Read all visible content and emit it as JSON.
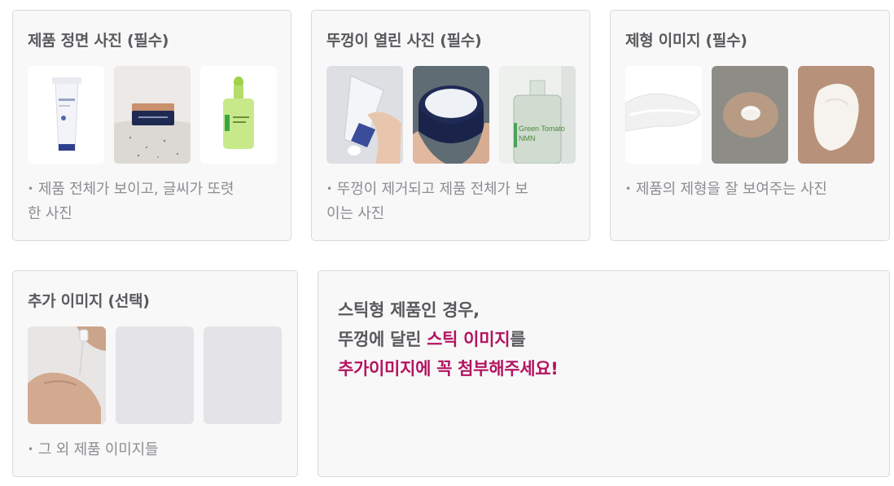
{
  "cards": [
    {
      "title": "제품 정면 사진 (필수)",
      "desc_line1": "제품 전체가 보이고, 글씨가 또렷",
      "desc_line2": "한 사진",
      "images": [
        "tube-front-photo",
        "jar-front-photo",
        "dropper-bottle-front-photo"
      ]
    },
    {
      "title": "뚜껑이 열린 사진 (필수)",
      "desc_line1": "뚜껑이 제거되고 제품 전체가 보",
      "desc_line2": "이는 사진",
      "images": [
        "open-tube-photo",
        "open-jar-photo",
        "open-bottle-photo"
      ],
      "bottle_label_1": "Green Tomato",
      "bottle_label_2": "NMN"
    },
    {
      "title": "제형 이미지 (필수)",
      "desc_line1": "제품의 제형을 잘 보여주는 사진",
      "images": [
        "cream-swatch-photo",
        "hand-swatch-photo",
        "cream-texture-photo"
      ]
    },
    {
      "title": "추가 이미지 (선택)",
      "desc_line1": "그 외 제품 이미지들",
      "images": [
        "dropper-hand-photo",
        "empty-slot",
        "empty-slot"
      ]
    }
  ],
  "bullet": "•",
  "notice": {
    "line1": "스틱형 제품인 경우,",
    "line2_prefix": "뚜껑에 달린 ",
    "line2_accent": "스틱 이미지",
    "line2_suffix": "를",
    "line3": "추가이미지에 꼭 첨부해주세요!"
  },
  "colors": {
    "card_bg": "#f8f8f9",
    "border": "#d9d9dc",
    "title": "#5a5a5e",
    "desc": "#8d8d92",
    "accent": "#b3145f"
  }
}
